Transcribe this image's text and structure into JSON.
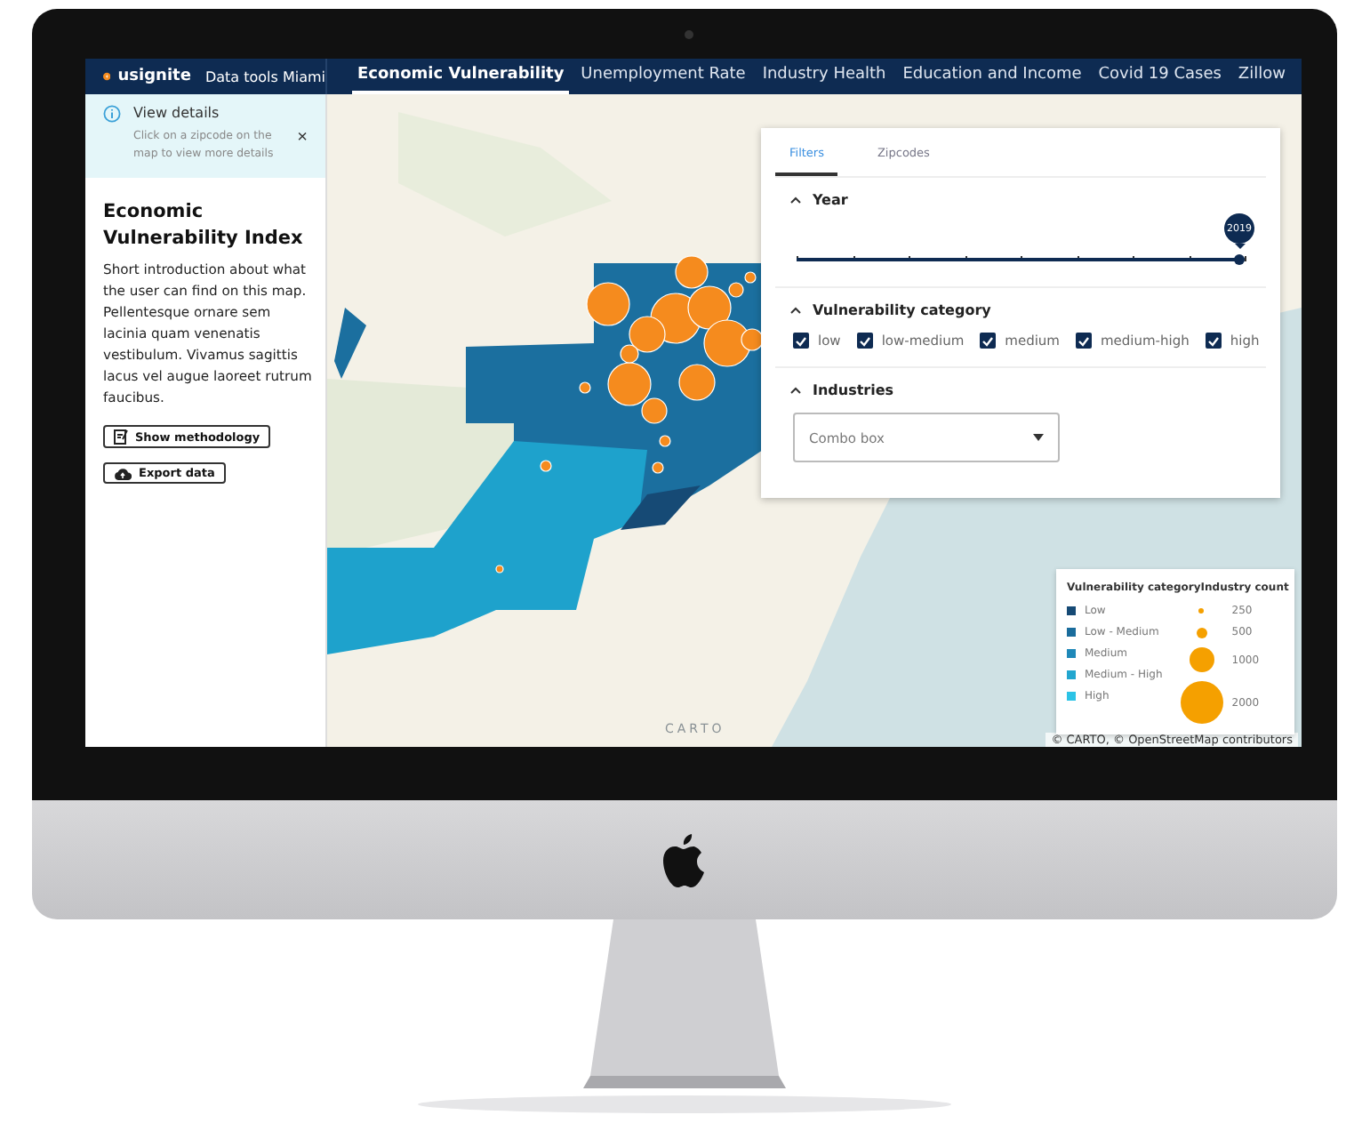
{
  "navbar": {
    "brand": "usignite",
    "product": "Data tools Miami",
    "tabs": [
      {
        "label": "Economic Vulnerability",
        "selected": true
      },
      {
        "label": "Unemployment Rate",
        "selected": false
      },
      {
        "label": "Industry Health",
        "selected": false
      },
      {
        "label": "Education and Income",
        "selected": false
      },
      {
        "label": "Covid 19 Cases",
        "selected": false
      },
      {
        "label": "Zillow",
        "selected": false
      }
    ]
  },
  "sidebar": {
    "notice": {
      "title": "View details",
      "text": "Click on a zipcode on the map to view more details",
      "close": "×"
    },
    "title": "Economic Vulnerability Index",
    "intro": "Short introduction about what the user can find on this map. Pellentesque ornare sem lacinia quam venenatis vestibulum. Vivamus sagittis lacus vel augue laoreet rutrum faucibus.",
    "buttons": [
      {
        "kind": "methodology",
        "label": "Show methodology"
      },
      {
        "kind": "export",
        "label": "Export data"
      }
    ]
  },
  "filters": {
    "tabs": [
      {
        "label": "Filters",
        "selected": true
      },
      {
        "label": "Zipcodes",
        "selected": false
      }
    ],
    "sections": [
      {
        "kind": "slider",
        "title": "Year",
        "expanded": true,
        "value": "2019",
        "level": 1
      },
      {
        "kind": "checkboxes",
        "title": "Vulnerability category",
        "expanded": true,
        "options": [
          {
            "label": "low",
            "checked": true
          },
          {
            "label": "low-medium",
            "checked": true
          },
          {
            "label": "medium",
            "checked": true
          },
          {
            "label": "medium-high",
            "checked": true
          },
          {
            "label": "high",
            "checked": true
          }
        ]
      },
      {
        "kind": "combo",
        "title": "Industries",
        "expanded": true,
        "placeholder": "Combo box"
      }
    ]
  },
  "legend": {
    "title": "Vulnerability categoryIndustry count",
    "categories": [
      {
        "label": "Low",
        "color": "#164a75"
      },
      {
        "label": "Low - Medium",
        "color": "#1a6c9c"
      },
      {
        "label": "Medium",
        "color": "#1f88b8"
      },
      {
        "label": "Medium - High",
        "color": "#22a6cf"
      },
      {
        "label": "High",
        "color": "#2cc3e6"
      }
    ],
    "counts": [
      "250",
      "500",
      "1000",
      "2000"
    ]
  },
  "map": {
    "logo": "CARTO",
    "attribution": "© CARTO, © OpenStreetMap contributors"
  }
}
